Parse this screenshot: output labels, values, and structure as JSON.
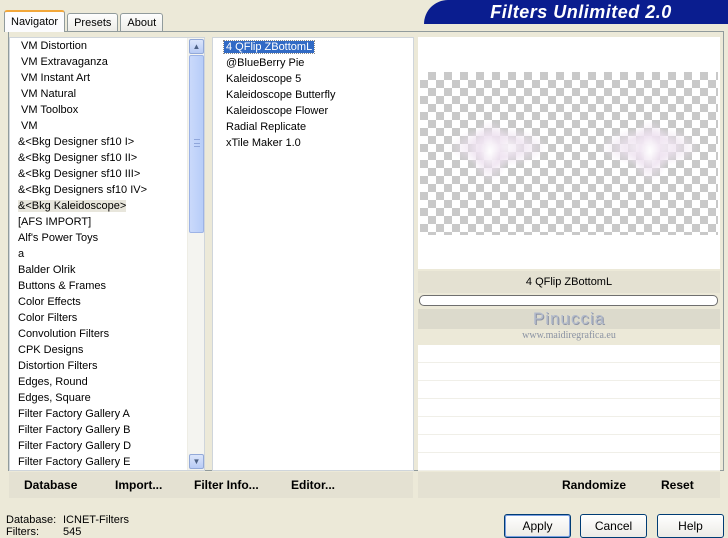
{
  "tabs": [
    {
      "label": "Navigator",
      "active": true
    },
    {
      "label": "Presets",
      "active": false
    },
    {
      "label": "About",
      "active": false
    }
  ],
  "app_title": "Filters Unlimited 2.0",
  "categories": [
    "VM Distortion",
    "VM Extravaganza",
    "VM Instant Art",
    "VM Natural",
    "VM Toolbox",
    "VM",
    "&<Bkg Designer sf10 I>",
    "&<Bkg Designer sf10 II>",
    "&<Bkg Designer sf10 III>",
    "&<Bkg Designers sf10 IV>",
    "&<Bkg Kaleidoscope>",
    "[AFS IMPORT]",
    "Alf's Power Toys",
    "a",
    "Balder Olrik",
    "Buttons & Frames",
    "Color Effects",
    "Color Filters",
    "Convolution Filters",
    "CPK Designs",
    "Distortion Filters",
    "Edges, Round",
    "Edges, Square",
    "Filter Factory Gallery A",
    "Filter Factory Gallery B",
    "Filter Factory Gallery D",
    "Filter Factory Gallery E"
  ],
  "selected_category": "&<Bkg Kaleidoscope>",
  "filters": [
    "4 QFlip ZBottomL",
    "@BlueBerry Pie",
    "Kaleidoscope 5",
    "Kaleidoscope Butterfly",
    "Kaleidoscope Flower",
    "Radial Replicate",
    "xTile Maker 1.0"
  ],
  "selected_filter": "4 QFlip ZBottomL",
  "preview": {
    "filter_name": "4 QFlip ZBottomL",
    "watermark_name": "Pinuccia",
    "watermark_site": "www.maidiregrafica.eu"
  },
  "bottom_links": {
    "database": "Database",
    "import": "Import...",
    "filter_info": "Filter Info...",
    "editor": "Editor...",
    "randomize": "Randomize",
    "reset": "Reset"
  },
  "status": {
    "database_label": "Database:",
    "database_value": "ICNET-Filters",
    "filters_label": "Filters:",
    "filters_value": "545"
  },
  "buttons": {
    "apply": "Apply",
    "cancel": "Cancel",
    "help": "Help"
  }
}
